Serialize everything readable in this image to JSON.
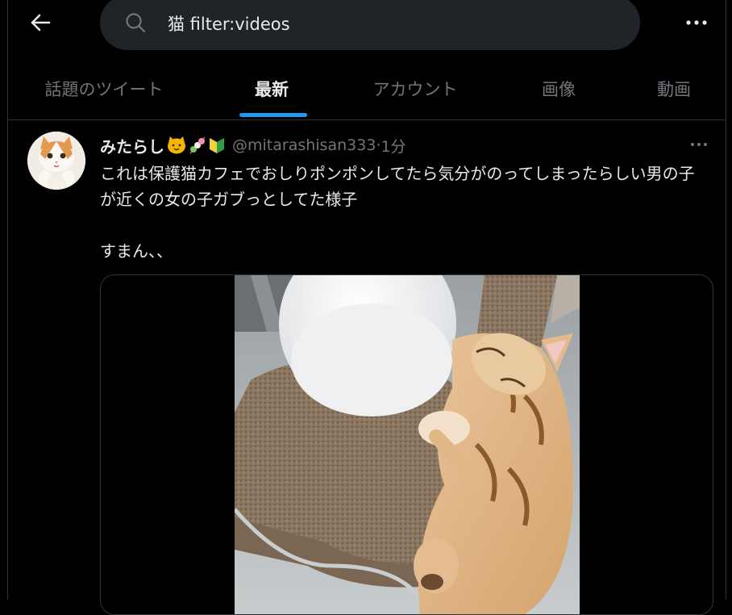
{
  "search": {
    "query": "猫 filter:videos"
  },
  "tabs": [
    {
      "label": "話題のツイート"
    },
    {
      "label": "最新"
    },
    {
      "label": "アカウント"
    },
    {
      "label": "画像"
    },
    {
      "label": "動画"
    }
  ],
  "tweet": {
    "display_name": "みたらし",
    "handle": "@mitarashisan333",
    "separator": " · ",
    "time": "1分",
    "text": "これは保護猫カフェでおしりポンポンしてたら気分がのってしまったらしい男の子が近くの女の子ガブっとしてた様子\n\nすまん、、"
  },
  "colors": {
    "accent": "#1d9bf0",
    "background": "#000000",
    "search_bg": "#202327",
    "muted_text": "#71767b",
    "primary_text": "#e7e9ea"
  }
}
